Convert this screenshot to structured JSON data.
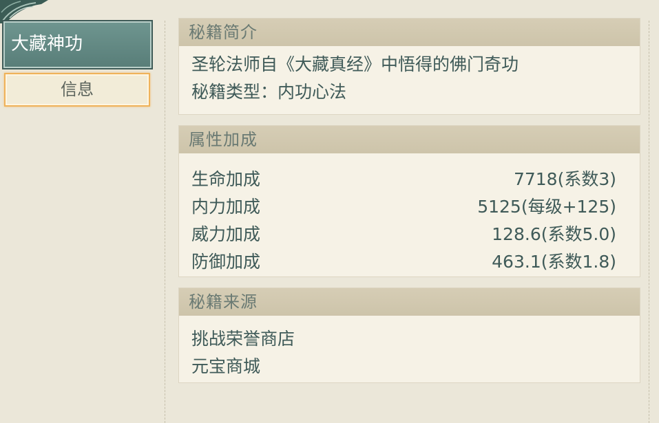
{
  "sidebar": {
    "title_tab": "大藏神功",
    "info_tab": "信息"
  },
  "intro": {
    "header": "秘籍简介",
    "description": "圣轮法师自《大藏真经》中悟得的佛门奇功",
    "type_line": "秘籍类型：内功心法"
  },
  "attributes": {
    "header": "属性加成",
    "rows": [
      {
        "label": "生命加成",
        "value": "7718(系数3)"
      },
      {
        "label": "内力加成",
        "value": "5125(每级+125)"
      },
      {
        "label": "威力加成",
        "value": "128.6(系数5.0)"
      },
      {
        "label": "防御加成",
        "value": "463.1(系数1.8)"
      }
    ]
  },
  "source": {
    "header": "秘籍来源",
    "items": [
      "挑战荣誉商店",
      "元宝商城"
    ]
  },
  "colors": {
    "active_tab": "#6f9690",
    "info_tab_border": "#efb25a",
    "panel_header": "#d6cdb5",
    "text": "#3f5a58",
    "background": "#ebe7d9",
    "top_frame": "#3b5c55"
  }
}
